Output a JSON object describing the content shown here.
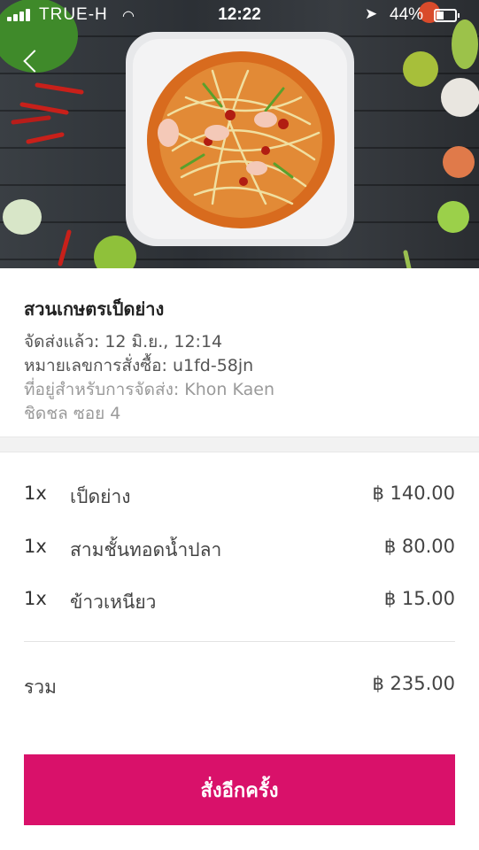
{
  "status_bar": {
    "carrier": "TRUE-H",
    "time": "12:22",
    "battery_percent": "44%",
    "battery_level": 0.44
  },
  "nav": {
    "back_icon": "chevron-left-icon"
  },
  "restaurant": {
    "name": "สวนเกษตรเป็ดย่าง",
    "delivered_line": "จัดส่งแล้ว: 12 มิ.ย., 12:14",
    "order_number_line": "หมายเลขการสั่งซื้อ: u1fd-58jn",
    "address_line_1": "ที่อยู่สำหรับการจัดส่ง: Khon Kaen",
    "address_line_2": "ชิดชล ซอย 4"
  },
  "items": [
    {
      "qty": "1x",
      "name": "เป็ดย่าง",
      "price": "฿ 140.00"
    },
    {
      "qty": "1x",
      "name": "สามชั้นทอดน้ำปลา",
      "price": "฿ 80.00"
    },
    {
      "qty": "1x",
      "name": "ข้าวเหนียว",
      "price": "฿ 15.00"
    }
  ],
  "summary": {
    "total_label": "รวม",
    "total_value": "฿ 235.00"
  },
  "actions": {
    "reorder_label": "สั่งอีกครั้ง"
  },
  "colors": {
    "accent": "#d9116a"
  }
}
